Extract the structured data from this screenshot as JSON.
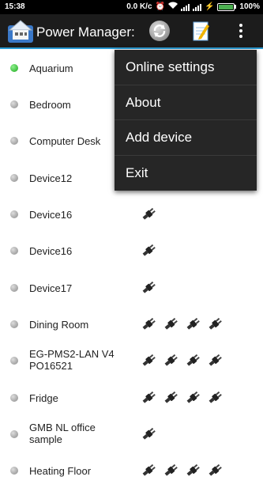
{
  "status": {
    "time": "15:38",
    "speed": "0.0 K/c",
    "battery": "100%"
  },
  "app": {
    "title": "Power Manager:"
  },
  "devices": [
    {
      "name": "Aquarium",
      "on": true,
      "plugs": 0
    },
    {
      "name": "Bedroom",
      "on": false,
      "plugs": 0
    },
    {
      "name": "Computer Desk",
      "on": false,
      "plugs": 0
    },
    {
      "name": "Device12",
      "on": false,
      "plugs": 0
    },
    {
      "name": "Device16",
      "on": false,
      "plugs": 1
    },
    {
      "name": "Device16",
      "on": false,
      "plugs": 1
    },
    {
      "name": "Device17",
      "on": false,
      "plugs": 1
    },
    {
      "name": "Dining Room",
      "on": false,
      "plugs": 4
    },
    {
      "name": "EG-PMS2-LAN V4 PO16521",
      "on": false,
      "plugs": 4
    },
    {
      "name": "Fridge",
      "on": false,
      "plugs": 4
    },
    {
      "name": "GMB NL office sample",
      "on": false,
      "plugs": 1
    },
    {
      "name": "Heating Floor",
      "on": false,
      "plugs": 4
    }
  ],
  "menu": {
    "items": [
      "Online settings",
      "About",
      "Add device",
      "Exit"
    ]
  },
  "colors": {
    "accent": "#2a9bd4",
    "on_led": "#1aa81a",
    "off_led": "#8a8a8a"
  }
}
